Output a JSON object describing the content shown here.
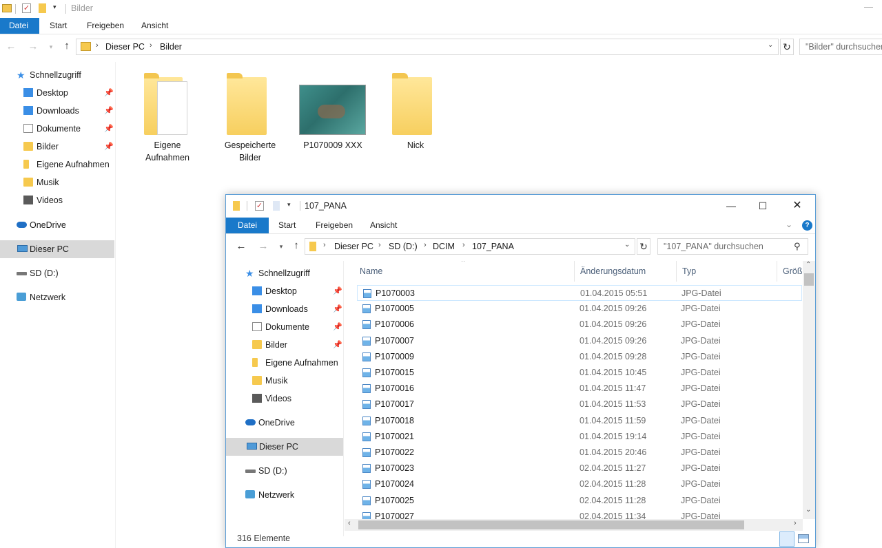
{
  "back_window": {
    "title": "Bilder",
    "ribbon_tabs": [
      "Datei",
      "Start",
      "Freigeben",
      "Ansicht"
    ],
    "breadcrumb": [
      "Dieser PC",
      "Bilder"
    ],
    "search_placeholder": "\"Bilder\" durchsuchen",
    "sidebar": {
      "quick_access": "Schnellzugriff",
      "items": [
        "Desktop",
        "Downloads",
        "Dokumente",
        "Bilder",
        "Eigene Aufnahmen",
        "Musik",
        "Videos"
      ],
      "onedrive": "OneDrive",
      "this_pc": "Dieser PC",
      "sd": "SD (D:)",
      "network": "Netzwerk"
    },
    "tiles": [
      {
        "label_line1": "Eigene",
        "label_line2": "Aufnahmen"
      },
      {
        "label_line1": "Gespeicherte",
        "label_line2": "Bilder"
      },
      {
        "label_line1": "P1070009 XXX",
        "label_line2": ""
      },
      {
        "label_line1": "Nick",
        "label_line2": ""
      }
    ]
  },
  "front_window": {
    "title": "107_PANA",
    "ribbon_tabs": [
      "Datei",
      "Start",
      "Freigeben",
      "Ansicht"
    ],
    "breadcrumb": [
      "Dieser PC",
      "SD (D:)",
      "DCIM",
      "107_PANA"
    ],
    "search_placeholder": "\"107_PANA\" durchsuchen",
    "sidebar": {
      "quick_access": "Schnellzugriff",
      "items": [
        "Desktop",
        "Downloads",
        "Dokumente",
        "Bilder",
        "Eigene Aufnahmen",
        "Musik",
        "Videos"
      ],
      "onedrive": "OneDrive",
      "this_pc": "Dieser PC",
      "sd": "SD (D:)",
      "network": "Netzwerk"
    },
    "columns": {
      "name": "Name",
      "date": "Änderungsdatum",
      "type": "Typ",
      "size": "Größ"
    },
    "files": [
      {
        "name": "P1070003",
        "date": "01.04.2015 05:51",
        "type": "JPG-Datei"
      },
      {
        "name": "P1070005",
        "date": "01.04.2015 09:26",
        "type": "JPG-Datei"
      },
      {
        "name": "P1070006",
        "date": "01.04.2015 09:26",
        "type": "JPG-Datei"
      },
      {
        "name": "P1070007",
        "date": "01.04.2015 09:26",
        "type": "JPG-Datei"
      },
      {
        "name": "P1070009",
        "date": "01.04.2015 09:28",
        "type": "JPG-Datei"
      },
      {
        "name": "P1070015",
        "date": "01.04.2015 10:45",
        "type": "JPG-Datei"
      },
      {
        "name": "P1070016",
        "date": "01.04.2015 11:47",
        "type": "JPG-Datei"
      },
      {
        "name": "P1070017",
        "date": "01.04.2015 11:53",
        "type": "JPG-Datei"
      },
      {
        "name": "P1070018",
        "date": "01.04.2015 11:59",
        "type": "JPG-Datei"
      },
      {
        "name": "P1070021",
        "date": "01.04.2015 19:14",
        "type": "JPG-Datei"
      },
      {
        "name": "P1070022",
        "date": "01.04.2015 20:46",
        "type": "JPG-Datei"
      },
      {
        "name": "P1070023",
        "date": "02.04.2015 11:27",
        "type": "JPG-Datei"
      },
      {
        "name": "P1070024",
        "date": "02.04.2015 11:28",
        "type": "JPG-Datei"
      },
      {
        "name": "P1070025",
        "date": "02.04.2015 11:28",
        "type": "JPG-Datei"
      },
      {
        "name": "P1070027",
        "date": "02.04.2015 11:34",
        "type": "JPG-Datei"
      }
    ],
    "status": "316 Elemente"
  },
  "colors": {
    "accent": "#1979ca",
    "selected": "#d9d9d9",
    "folder": "#f6c94e"
  }
}
